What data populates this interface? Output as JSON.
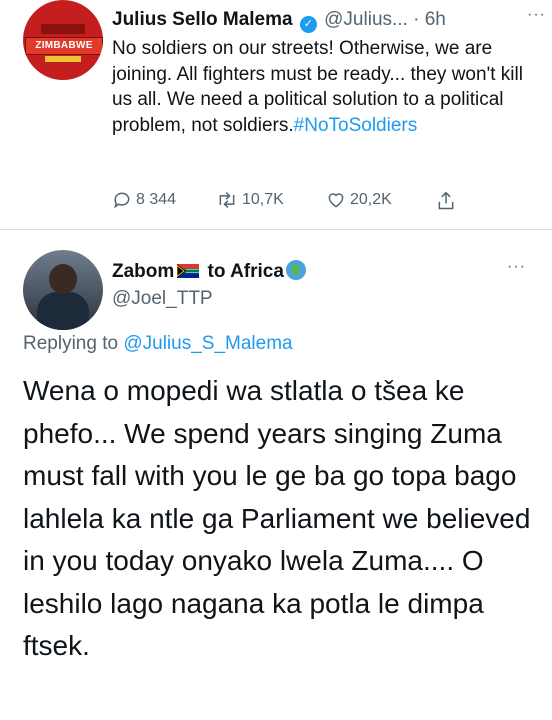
{
  "tweet1": {
    "avatar_text": "ZIMBABWE",
    "name": "Julius Sello Malema",
    "handle": "@Julius...",
    "time": "· 6h",
    "more": "···",
    "text": "No soldiers on our streets! Otherwise, we are joining. All fighters must be ready... they won't kill us all. We need a political solution to a political problem, not soldiers.",
    "hashtag": "#NoToSoldiers",
    "replies": "8 344",
    "retweets": "10,7K",
    "likes": "20,2K"
  },
  "tweet2": {
    "name_part1": "Zabom",
    "name_part2": " to Africa",
    "handle": "@Joel_TTP",
    "more": "···",
    "replying_label": "Replying to ",
    "replying_to": "@Julius_S_Malema",
    "text": "Wena o mopedi wa stlatla o tšea ke phefo... We spend years singing Zuma must fall with you le ge ba go topa bago lahlela ka ntle ga Parliament we believed in you today onyako lwela Zuma.... O leshilo lago nagana ka potla le dimpa ftsek."
  },
  "colors": {
    "link": "#1d9bf0",
    "secondary_text": "#536471",
    "primary_text": "#0f1419"
  }
}
